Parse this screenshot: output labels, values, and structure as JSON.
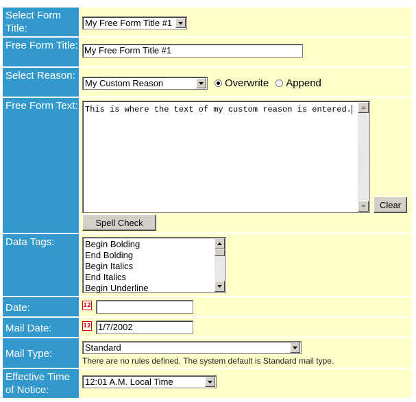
{
  "form": {
    "select_form_title": {
      "label": "Select Form Title:",
      "value": "My Free Form Title #1"
    },
    "free_form_title": {
      "label": "Free Form Title:",
      "value": "My Free Form Title #1"
    },
    "select_reason": {
      "label": "Select Reason:",
      "value": "My Custom Reason",
      "mode_options": [
        {
          "label": "Overwrite",
          "selected": true
        },
        {
          "label": "Append",
          "selected": false
        }
      ]
    },
    "free_form_text": {
      "label": "Free Form Text:",
      "value": "This is where the text of my custom reason is entered.",
      "clear_label": "Clear",
      "spell_check_label": "Spell Check"
    },
    "data_tags": {
      "label": "Data Tags:",
      "items": [
        "Begin Bolding",
        "End Bolding",
        "Begin Italics",
        "End Italics",
        "Begin Underline"
      ]
    },
    "date": {
      "label": "Date:",
      "value": "",
      "calendar_icon": "calendar-icon",
      "calendar_icon_text": "12"
    },
    "mail_date": {
      "label": "Mail Date:",
      "value": "1/7/2002",
      "calendar_icon": "calendar-icon",
      "calendar_icon_text": "12"
    },
    "mail_type": {
      "label": "Mail Type:",
      "value": "Standard",
      "note": "There are no rules defined. The system default is Standard mail type."
    },
    "effective_time": {
      "label": "Effective Time of Notice:",
      "value": "12:01 A.M. Local Time"
    }
  },
  "colors": {
    "label_bg": "#3399cc",
    "value_bg": "#ffffcc",
    "label_text": "#ffffff"
  }
}
